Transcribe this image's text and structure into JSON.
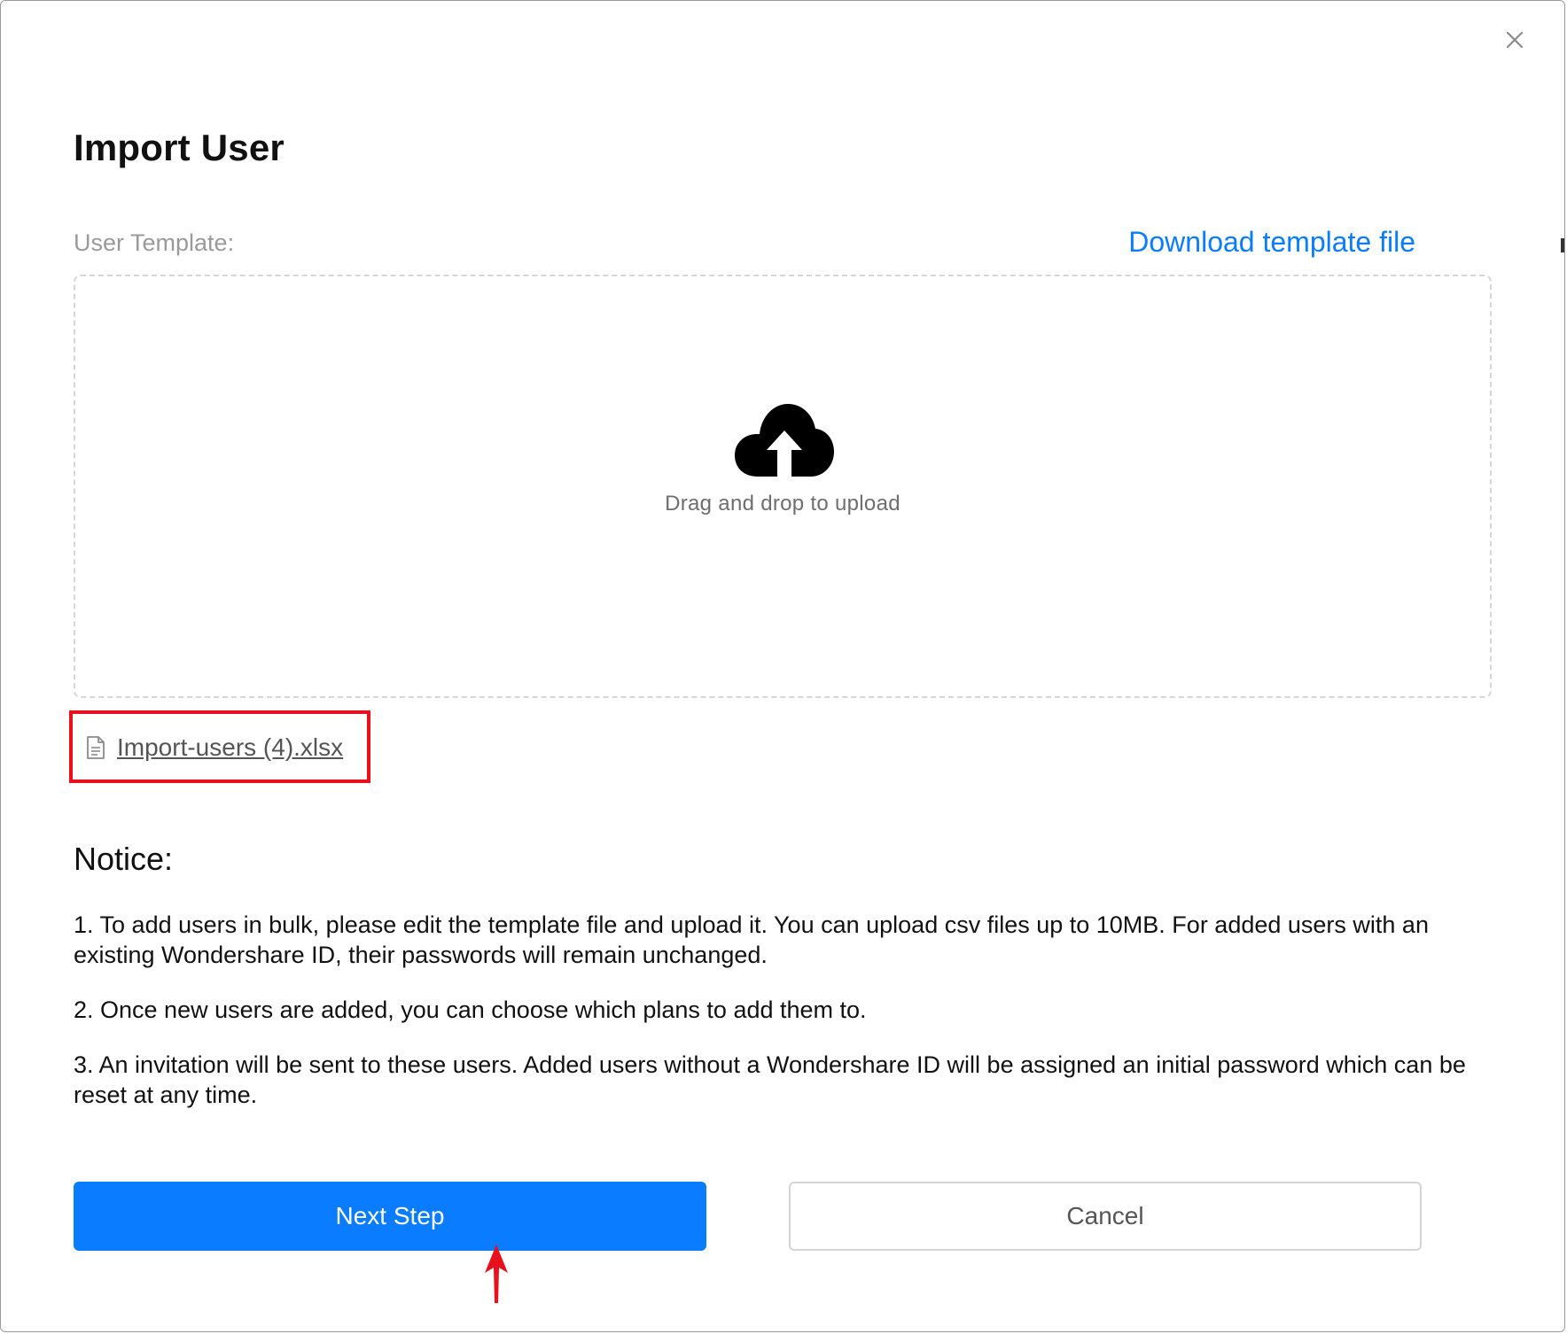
{
  "dialog": {
    "title": "Import User",
    "close_icon": "close-icon"
  },
  "template": {
    "label": "User Template:",
    "download_link": "Download template file"
  },
  "dropzone": {
    "icon": "cloud-upload-icon",
    "text": "Drag and drop to upload"
  },
  "uploaded_file": {
    "icon": "document-icon",
    "name": "Import-users (4).xlsx",
    "highlight_color": "#e8101c"
  },
  "notice": {
    "heading": "Notice:",
    "items": [
      "1. To add users in bulk, please edit the template file and upload it. You can upload csv files up to 10MB. For added users with an existing Wondershare ID, their passwords will remain unchanged.",
      "2. Once new users are added, you can choose which plans to add them to.",
      "3. An invitation will be sent to these users. Added users without a Wondershare ID will be assigned an initial password which can be reset at any time."
    ]
  },
  "actions": {
    "next_label": "Next Step",
    "cancel_label": "Cancel"
  },
  "colors": {
    "accent": "#0a7cff",
    "annotation": "#e8101c"
  }
}
